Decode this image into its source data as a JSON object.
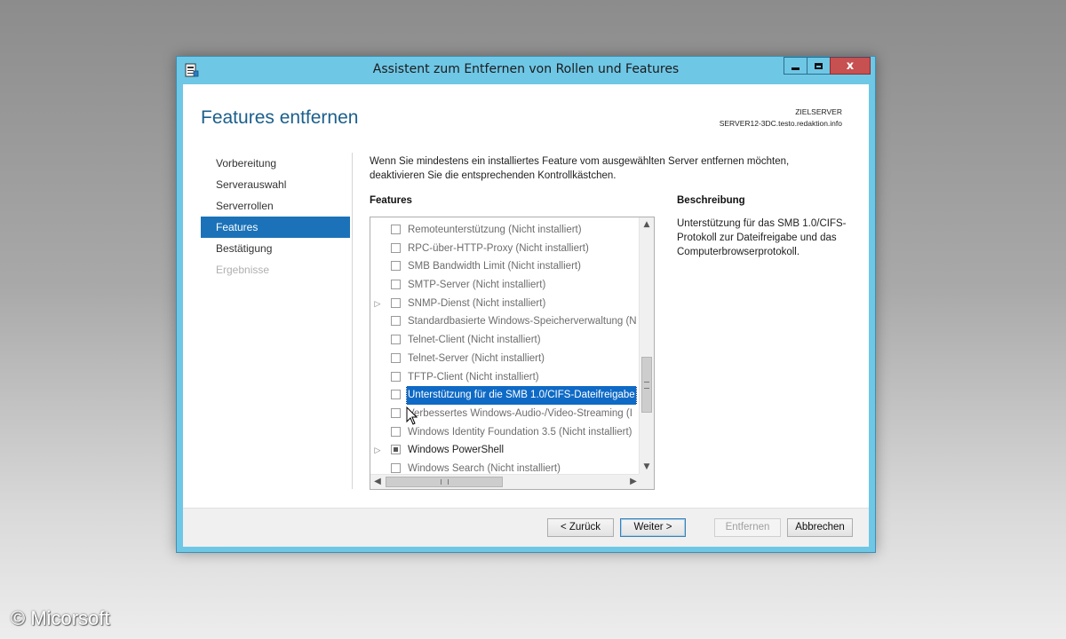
{
  "window": {
    "title": "Assistent zum Entfernen von Rollen und Features",
    "close_glyph": "x"
  },
  "header": {
    "page_title": "Features entfernen",
    "destination_label": "ZIELSERVER",
    "destination_server": "SERVER12-3DC.testo.redaktion.info"
  },
  "nav": {
    "items": [
      {
        "label": "Vorbereitung",
        "state": "normal"
      },
      {
        "label": "Serverauswahl",
        "state": "normal"
      },
      {
        "label": "Serverrollen",
        "state": "normal"
      },
      {
        "label": "Features",
        "state": "active"
      },
      {
        "label": "Bestätigung",
        "state": "normal"
      },
      {
        "label": "Ergebnisse",
        "state": "disabled"
      }
    ]
  },
  "main": {
    "intro": "Wenn Sie mindestens ein installiertes Feature vom ausgewählten Server entfernen möchten, deaktivieren Sie die entsprechenden Kontrollkästchen.",
    "features_label": "Features",
    "description_label": "Beschreibung",
    "description_text": "Unterstützung für das SMB 1.0/CIFS-Protokoll zur Dateifreigabe und das Computerbrowserprotokoll.",
    "features": [
      {
        "label": "Remoteunterstützung (Nicht installiert)",
        "expander": false,
        "installed": false,
        "check": "empty",
        "selected": false
      },
      {
        "label": "RPC-über-HTTP-Proxy (Nicht installiert)",
        "expander": false,
        "installed": false,
        "check": "empty",
        "selected": false
      },
      {
        "label": "SMB Bandwidth Limit (Nicht installiert)",
        "expander": false,
        "installed": false,
        "check": "empty",
        "selected": false
      },
      {
        "label": "SMTP-Server (Nicht installiert)",
        "expander": false,
        "installed": false,
        "check": "empty",
        "selected": false
      },
      {
        "label": "SNMP-Dienst (Nicht installiert)",
        "expander": true,
        "installed": false,
        "check": "empty",
        "selected": false
      },
      {
        "label": "Standardbasierte Windows-Speicherverwaltung (N",
        "expander": false,
        "installed": false,
        "check": "empty",
        "selected": false
      },
      {
        "label": "Telnet-Client (Nicht installiert)",
        "expander": false,
        "installed": false,
        "check": "empty",
        "selected": false
      },
      {
        "label": "Telnet-Server (Nicht installiert)",
        "expander": false,
        "installed": false,
        "check": "empty",
        "selected": false
      },
      {
        "label": "TFTP-Client (Nicht installiert)",
        "expander": false,
        "installed": false,
        "check": "empty",
        "selected": false
      },
      {
        "label": "Unterstützung für die SMB 1.0/CIFS-Dateifreigabe",
        "expander": false,
        "installed": true,
        "check": "empty",
        "selected": true
      },
      {
        "label": "Verbessertes Windows-Audio-/Video-Streaming (I",
        "expander": false,
        "installed": false,
        "check": "empty",
        "selected": false
      },
      {
        "label": "Windows Identity Foundation 3.5 (Nicht installiert)",
        "expander": false,
        "installed": false,
        "check": "empty",
        "selected": false
      },
      {
        "label": "Windows PowerShell",
        "expander": true,
        "installed": true,
        "check": "partial",
        "selected": false
      },
      {
        "label": "Windows Search (Nicht installiert)",
        "expander": false,
        "installed": false,
        "check": "empty",
        "selected": false
      }
    ]
  },
  "buttons": {
    "back": "< Zurück",
    "next": "Weiter >",
    "remove": "Entfernen",
    "cancel": "Abbrechen"
  },
  "watermark": "© Micorsoft",
  "colors": {
    "accent": "#1b72b8",
    "title_bar": "#6fc7e6",
    "page_title": "#1b5f8c",
    "close_button": "#c75050"
  }
}
